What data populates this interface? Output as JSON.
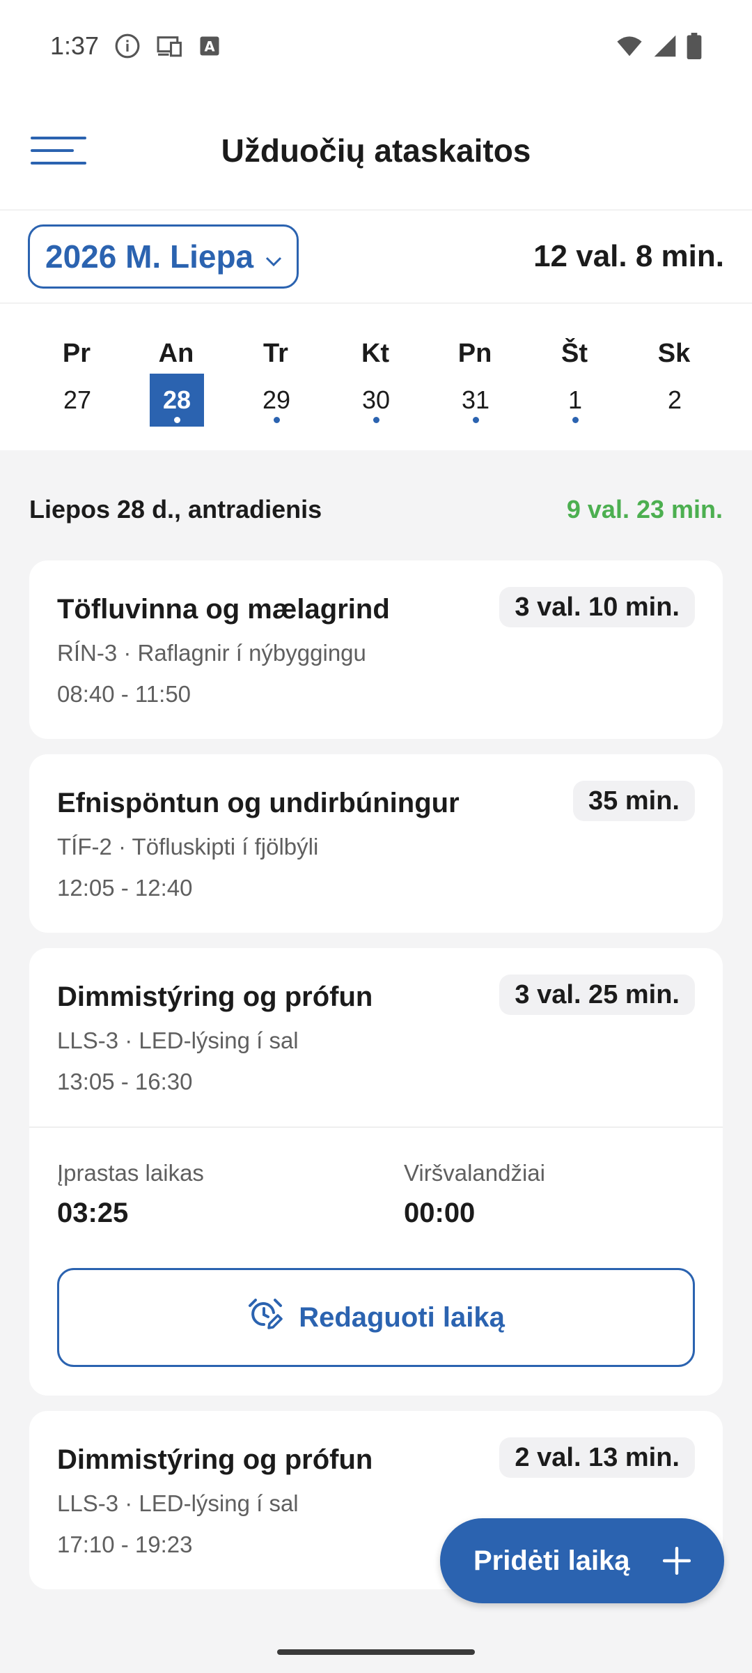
{
  "status_bar": {
    "time": "1:37",
    "left_icons": [
      "info-icon",
      "devices-icon",
      "keyboard-a-icon"
    ],
    "right_icons": [
      "wifi-icon",
      "signal-icon",
      "battery-icon"
    ]
  },
  "app_bar": {
    "title": "Užduočių ataskaitos",
    "menu_icon": "hamburger-menu-icon"
  },
  "period": {
    "selected_month": "2026 M. Liepa",
    "total": "12 val. 8 min."
  },
  "week": [
    {
      "name": "Pr",
      "num": "27",
      "has_entries": false,
      "selected": false
    },
    {
      "name": "An",
      "num": "28",
      "has_entries": true,
      "selected": true
    },
    {
      "name": "Tr",
      "num": "29",
      "has_entries": true,
      "selected": false
    },
    {
      "name": "Kt",
      "num": "30",
      "has_entries": true,
      "selected": false
    },
    {
      "name": "Pn",
      "num": "31",
      "has_entries": true,
      "selected": false
    },
    {
      "name": "Št",
      "num": "1",
      "has_entries": true,
      "selected": false
    },
    {
      "name": "Sk",
      "num": "2",
      "has_entries": false,
      "selected": false
    }
  ],
  "day_summary": {
    "title": "Liepos 28 d., antradienis",
    "total": "9 val. 23 min."
  },
  "entries": [
    {
      "title": "Töfluvinna og mælagrind",
      "duration": "3 val. 10 min.",
      "subtitle": "RÍN-3 · Raflagnir í nýbyggingu",
      "time_range": "08:40 - 11:50"
    },
    {
      "title": "Efnispöntun og undirbúningur",
      "duration": "35 min.",
      "subtitle": "TÍF-2 · Töfluskipti í fjölbýli",
      "time_range": "12:05 - 12:40"
    },
    {
      "title": "Dimmistýring og prófun",
      "duration": "3 val. 25 min.",
      "subtitle": "LLS-3 · LED-lýsing í sal",
      "time_range": "13:05 - 16:30",
      "expanded": {
        "regular_label": "Įprastas laikas",
        "regular_value": "03:25",
        "overtime_label": "Viršvalandžiai",
        "overtime_value": "00:00",
        "edit_label": "Redaguoti laiką",
        "edit_icon": "alarm-edit-icon"
      }
    },
    {
      "title": "Dimmistýring og prófun",
      "duration": "2 val. 13 min.",
      "subtitle": "LLS-3 · LED-lýsing í sal",
      "time_range": "17:10 - 19:23"
    }
  ],
  "fab": {
    "label": "Pridėti laiką",
    "icon": "plus-icon"
  },
  "colors": {
    "accent": "#2B63B0",
    "positive": "#4CAF50",
    "background": "#F4F4F5"
  }
}
